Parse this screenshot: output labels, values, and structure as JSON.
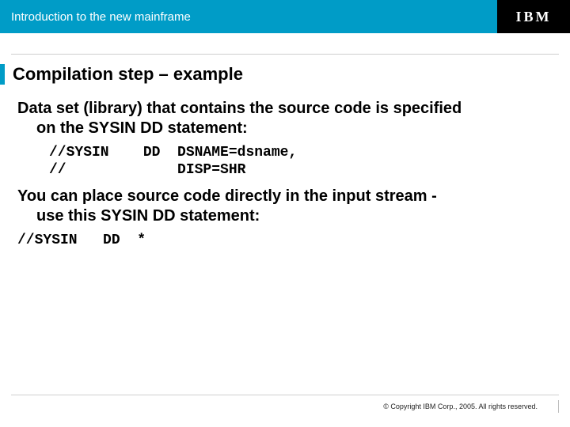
{
  "header": {
    "subtitle": "Introduction to the new mainframe",
    "logo_text": "IBM"
  },
  "title": "Compilation step – example",
  "paragraphs": {
    "p1_lead": "Data set (library) that contains the source code is specified",
    "p1_rest": "on the SYSIN DD statement:",
    "p2_lead": "You can place source code directly in the input stream -",
    "p2_rest": "use this SYSIN DD statement:"
  },
  "code": {
    "block1": "//SYSIN    DD  DSNAME=dsname,\n//             DISP=SHR",
    "block2": "//SYSIN   DD  *"
  },
  "footer": {
    "copyright": "© Copyright IBM Corp., 2005. All rights reserved."
  }
}
